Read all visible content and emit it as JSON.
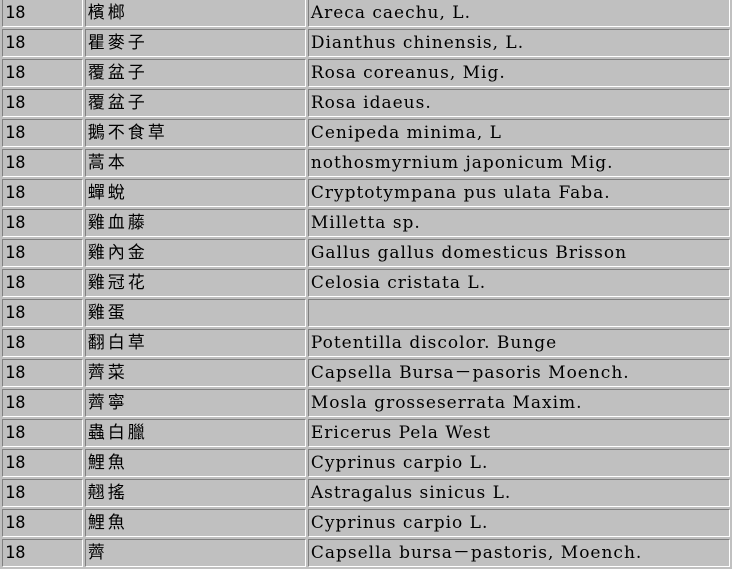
{
  "table": {
    "rows": [
      {
        "num": "18",
        "name": "檳榔",
        "sci": "Areca caechu, L."
      },
      {
        "num": "18",
        "name": "瞿麥子",
        "sci": "Dianthus chinensis, L."
      },
      {
        "num": "18",
        "name": "覆盆子",
        "sci": "Rosa coreanus, Mig."
      },
      {
        "num": "18",
        "name": "覆盆子",
        "sci": "Rosa idaeus."
      },
      {
        "num": "18",
        "name": "鵝不食草",
        "sci": "Cenipeda minima, L"
      },
      {
        "num": "18",
        "name": "蒿本",
        "sci": "nothosmyrnium japonicum Mig."
      },
      {
        "num": "18",
        "name": "蟬蛻",
        "sci": "Cryptotympana pus ulata Faba."
      },
      {
        "num": "18",
        "name": "雞血藤",
        "sci": "Milletta sp."
      },
      {
        "num": "18",
        "name": "雞內金",
        "sci": "Gallus gallus domesticus Brisson"
      },
      {
        "num": "18",
        "name": "雞冠花",
        "sci": "Celosia cristata L."
      },
      {
        "num": "18",
        "name": "雞蛋",
        "sci": ""
      },
      {
        "num": "18",
        "name": "翻白草",
        "sci": "Potentilla discolor. Bunge"
      },
      {
        "num": "18",
        "name": "薺菜",
        "sci": "Capsella Bursa－pasoris Moench."
      },
      {
        "num": "18",
        "name": "薺寧",
        "sci": "Mosla grosseserrata Maxim."
      },
      {
        "num": "18",
        "name": "蟲白臘",
        "sci": "Ericerus Pela West"
      },
      {
        "num": "18",
        "name": "鯉魚",
        "sci": "Cyprinus carpio L."
      },
      {
        "num": "18",
        "name": "翹搖",
        "sci": "Astragalus sinicus L."
      },
      {
        "num": "18",
        "name": "鯉魚",
        "sci": "Cyprinus carpio L."
      },
      {
        "num": "18",
        "name": "薺",
        "sci": "Capsella bursa－pastoris, Moench."
      }
    ]
  }
}
